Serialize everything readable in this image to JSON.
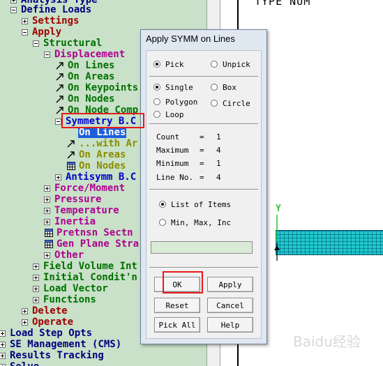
{
  "tree": {
    "items": [
      {
        "label": "Analysis Type",
        "color": "navy",
        "expander": "plus"
      },
      {
        "label": "Define Loads",
        "color": "navy",
        "expander": "minus"
      },
      {
        "label": "Settings",
        "color": "red",
        "expander": "plus"
      },
      {
        "label": "Apply",
        "color": "red",
        "expander": "minus"
      },
      {
        "label": "Structural",
        "color": "green",
        "expander": "minus"
      },
      {
        "label": "Displacement",
        "color": "magenta",
        "expander": "minus"
      },
      {
        "label": "On Lines",
        "color": "green",
        "icon": "arrow-icon"
      },
      {
        "label": "On Areas",
        "color": "green",
        "icon": "arrow-icon"
      },
      {
        "label": "On Keypoints",
        "color": "green",
        "icon": "arrow-icon"
      },
      {
        "label": "On Nodes",
        "color": "green",
        "icon": "arrow-icon"
      },
      {
        "label": "On Node Comp",
        "color": "green",
        "icon": "arrow-icon"
      },
      {
        "label": "Symmetry B.C",
        "color": "blue",
        "expander": "minus"
      },
      {
        "label": "On Lines",
        "color": "white",
        "selected": true
      },
      {
        "label": "...with Ar",
        "color": "olive",
        "icon": "arrow-icon"
      },
      {
        "label": "On Areas",
        "color": "olive",
        "icon": "arrow-icon"
      },
      {
        "label": "On Nodes",
        "color": "olive",
        "icon": "grid-icon"
      },
      {
        "label": "Antisymm B.C",
        "color": "blue",
        "expander": "plus"
      },
      {
        "label": "Force/Moment",
        "color": "magenta",
        "expander": "plus"
      },
      {
        "label": "Pressure",
        "color": "magenta",
        "expander": "plus"
      },
      {
        "label": "Temperature",
        "color": "magenta",
        "expander": "plus"
      },
      {
        "label": "Inertia",
        "color": "magenta",
        "expander": "plus"
      },
      {
        "label": "Pretnsn Sectn",
        "color": "magenta",
        "icon": "grid-icon"
      },
      {
        "label": "Gen Plane Stra",
        "color": "magenta",
        "icon": "grid-icon"
      },
      {
        "label": "Other",
        "color": "magenta",
        "expander": "plus"
      },
      {
        "label": "Field Volume Int",
        "color": "green",
        "expander": "plus"
      },
      {
        "label": "Initial Condit'n",
        "color": "green",
        "expander": "plus"
      },
      {
        "label": "Load Vector",
        "color": "green",
        "expander": "plus"
      },
      {
        "label": "Functions",
        "color": "green",
        "expander": "plus"
      },
      {
        "label": "Delete",
        "color": "red",
        "expander": "plus"
      },
      {
        "label": "Operate",
        "color": "red",
        "expander": "plus"
      },
      {
        "label": "Load Step Opts",
        "color": "navy",
        "expander": "plus"
      },
      {
        "label": "SE Management (CMS)",
        "color": "navy",
        "expander": "plus"
      },
      {
        "label": "Results Tracking",
        "color": "navy",
        "expander": "plus"
      },
      {
        "label": "Solve",
        "color": "navy",
        "expander": "plus"
      }
    ]
  },
  "graphics": {
    "title": "TYPE NUM",
    "y_axis_label": "Y"
  },
  "dialog": {
    "title": "Apply SYMM on Lines",
    "pick": "Pick",
    "unpick": "Unpick",
    "single": "Single",
    "box": "Box",
    "polygon": "Polygon",
    "circle": "Circle",
    "loop": "Loop",
    "count_label": "Count",
    "count_value": "1",
    "maximum_label": "Maximum",
    "maximum_value": "4",
    "minimum_label": "Minimum",
    "minimum_value": "1",
    "line_no_label": "Line No.",
    "line_no_value": "4",
    "eq": "=",
    "list_of_items": "List of Items",
    "min_max_inc": "Min, Max, Inc",
    "entry_value": "",
    "buttons": {
      "ok": "OK",
      "apply": "Apply",
      "reset": "Reset",
      "cancel": "Cancel",
      "pick_all": "Pick All",
      "help": "Help"
    }
  },
  "watermark": "Baidu经验"
}
